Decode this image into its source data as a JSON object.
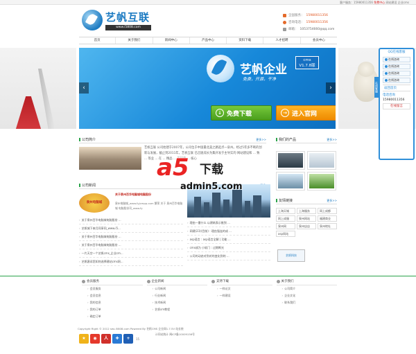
{
  "topbar": {
    "service_label": "客户服务：15980011356",
    "free_label": "免费中心",
    "links": [
      "网站建设",
      "企业cms"
    ]
  },
  "logo": {
    "name": "艺帆互联",
    "url": "www.i5808.com"
  },
  "contact": {
    "phone_label": "全国服务：",
    "phone": "15980011356",
    "tel_label": "咨询电话：",
    "tel": "15980011356",
    "mail_label": "邮箱：",
    "mail": "1053754660@qq.com"
  },
  "nav": [
    "首页",
    "关于我们",
    "新闻中心",
    "产品中心",
    "资料下载",
    "人才招聘",
    "会员中心"
  ],
  "banner": {
    "title": "艺帆企业",
    "badge_top": "cms",
    "badge_bottom": "V1.7.8版",
    "slogan": "免费，开源，干净",
    "download_button": "免费下载",
    "website_button": "进入官网",
    "prev": "‹",
    "next": "›"
  },
  "qq_panel": {
    "title": "QQ在线客服",
    "side_tab": "在线客服",
    "items": [
      "在线咨询",
      "在线咨询",
      "在线咨询",
      "在线咨询"
    ],
    "back_top": "返回首页",
    "phone_label": "电话咨询",
    "phone": "15980011356",
    "message": "在线留言"
  },
  "intro": {
    "heading": "公司简介",
    "more": "更多>>",
    "text": "艺帆互联 公司始建于2007年，公司位于中国最北美之路起点一泉州。经过5年多不断的创新与发展，截止到2011年，艺帆互联 已迅速成长为集开发于主导实的 网站建设和 ... 致 ... 等业 ... 在 ... 精品 ... 工程师 ... 核心"
  },
  "products": {
    "heading": "我们的产品",
    "more": "更多>>"
  },
  "news": {
    "heading": "公司新闻",
    "more": "更多>>",
    "featured_logo": "泉州电脑城",
    "featured_title": "关于泉州百华电脑城电脑股份",
    "featured_summary": "泉州电脑城_www.fyjcmpp.com 繁荣 关于 泉州百华电脑城 电脑股份司_www.fy",
    "items": [
      "关于泉州百华电脑城电脑股份 ...",
      "艺帆城下来月同享同_www.i5...",
      "关于泉州百华电脑城电脑股份 ...",
      "关于泉州百华电脑城电脑股份 ...",
      "一片天空一个艺帆cms_企业cm...",
      "艺帆客诉您如何选择建站cms网..."
    ],
    "items2": [
      "理由一番什么 以建筑表示推到 ...",
      "网建(23)(目前) : 理由强连的成 ...",
      "asp语言 : asp语言全解 | 功能 ...",
      "cms成为 小软门 : 过期断光",
      "公司的动态对到对的变化到的 ..."
    ]
  },
  "links": {
    "heading": "友情链接",
    "more": "更多>>",
    "items": [
      "上海天城",
      "上海服务",
      "网上成都",
      "网上成服",
      "泉州网站",
      "福建商业",
      "泉州网",
      "泉州店店",
      "泉州地址",
      "asp网站"
    ],
    "sponsor": "艺帆科技"
  },
  "watermark": {
    "logo": "a5",
    "text": "下载",
    "url": "admin5.com"
  },
  "footer": {
    "columns": [
      {
        "heading": "会员服务",
        "links": [
          "会员服务",
          "会员信息",
          "我的信息",
          "我的订单",
          "确定订单"
        ]
      },
      {
        "heading": "企业新闻",
        "links": [
          "公司新闻",
          "行业新闻",
          "技术新闻",
          "艺帆sm教程"
        ]
      },
      {
        "heading": "支持下载",
        "links": [
          "一样论文",
          "一样建设"
        ]
      },
      {
        "heading": "关于我们",
        "links": [
          "公司简介",
          "企业文化",
          "联系我们"
        ]
      }
    ],
    "copyright": "Copyright Right © 2012 seo.i5808.com Powered By 艺帆CMS 企业网1.7.5V 站长统",
    "icp": "计同站统计 闽ICP备10009156号",
    "badge_count": "15"
  }
}
